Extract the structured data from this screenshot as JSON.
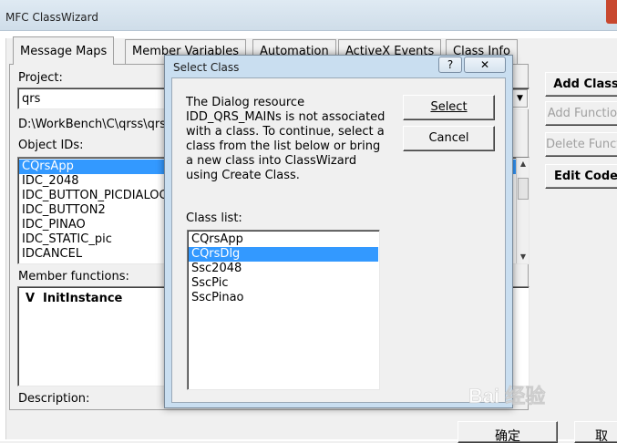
{
  "main": {
    "title": "MFC ClassWizard",
    "tabs": [
      {
        "label": "Message Maps"
      },
      {
        "label": "Member Variables"
      },
      {
        "label": "Automation"
      },
      {
        "label": "ActiveX Events"
      },
      {
        "label": "Class Info"
      }
    ],
    "project_label": "Project:",
    "project_value": "qrs",
    "path": "D:\\WorkBench\\C\\qrss\\qrs",
    "object_ids_label": "Object IDs:",
    "object_ids": [
      "CQrsApp",
      "IDC_2048",
      "IDC_BUTTON_PICDIALOG",
      "IDC_BUTTON2",
      "IDC_PINAO",
      "IDC_STATIC_pic",
      "IDCANCEL"
    ],
    "member_functions_label": "Member functions:",
    "member_function_prefix": "V",
    "member_function_name": "InitInstance",
    "description_label": "Description:",
    "right_buttons": [
      {
        "label": "Add Class"
      },
      {
        "label": "Add Function"
      },
      {
        "label": "Delete Function"
      },
      {
        "label": "Edit Code"
      }
    ],
    "ok_label": "确定",
    "cancel_label": "取"
  },
  "dialog": {
    "title": "Select Class",
    "help_glyph": "?",
    "close_glyph": "✕",
    "message": "The Dialog resource IDD_QRS_MAINs is not associated with a class.  To continue, select a class from the list below or bring a new class into ClassWizard using Create Class.",
    "select_label": "Select",
    "cancel_label": "Cancel",
    "class_list_label": "Class list:",
    "classes": [
      "CQrsApp",
      "CQrsDlg",
      "Ssc2048",
      "SscPic",
      "SscPinao"
    ],
    "selected_class": "CQrsDlg"
  },
  "colors": {
    "selection": "#3399ff",
    "dialog_frame": "#c9def0"
  },
  "watermark": {
    "text": "Bai 经验"
  }
}
